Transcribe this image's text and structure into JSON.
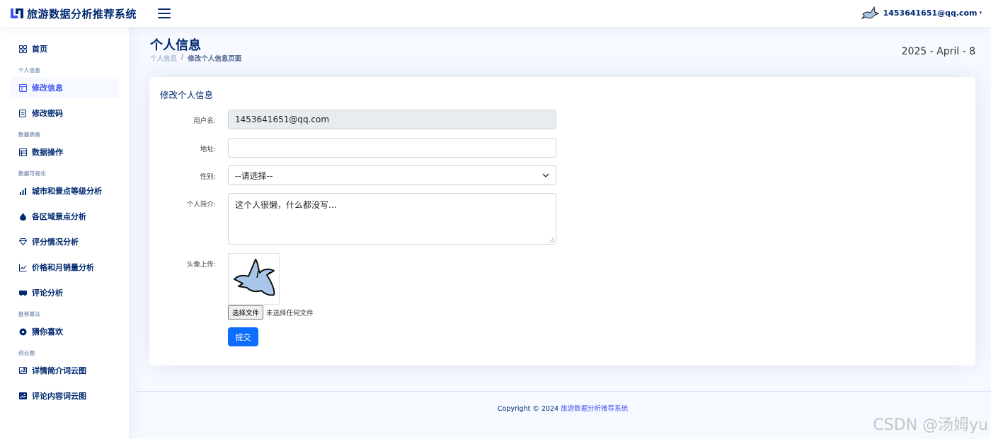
{
  "header": {
    "app_title": "旅游数据分析推荐系统",
    "user_name": "1453641651@qq.com",
    "caret": "▾"
  },
  "sidebar": {
    "items": [
      {
        "label": "首页",
        "icon": "grid-icon"
      },
      {
        "heading": "个人信息"
      },
      {
        "label": "修改信息",
        "icon": "layout-icon",
        "active": true
      },
      {
        "label": "修改密码",
        "icon": "document-icon"
      },
      {
        "heading": "数据表格"
      },
      {
        "label": "数据操作",
        "icon": "table-icon"
      },
      {
        "heading": "数据可视化"
      },
      {
        "label": "城市和景点等级分析",
        "icon": "bar-chart-icon"
      },
      {
        "label": "各区域景点分析",
        "icon": "droplet-icon"
      },
      {
        "label": "评分情况分析",
        "icon": "gem-icon"
      },
      {
        "label": "价格和月销量分析",
        "icon": "line-chart-icon"
      },
      {
        "label": "评论分析",
        "icon": "projector-icon"
      },
      {
        "heading": "推荐算法"
      },
      {
        "label": "猜你喜欢",
        "icon": "disc-icon"
      },
      {
        "heading": "词云图"
      },
      {
        "label": "详情简介词云图",
        "icon": "image-icon"
      },
      {
        "label": "评论内容词云图",
        "icon": "image-alt-icon"
      }
    ]
  },
  "page": {
    "title": "个人信息",
    "breadcrumb": [
      "个人信息",
      "/",
      "修改个人信息页面"
    ],
    "date": "2025 - April - 8"
  },
  "form": {
    "card_title": "修改个人信息",
    "username_label": "用户名:",
    "username_value": "1453641651@qq.com",
    "address_label": "地址:",
    "address_value": "",
    "gender_label": "性别:",
    "gender_value": "--请选择--",
    "bio_label": "个人简介:",
    "bio_value": "这个人很懒，什么都没写...",
    "avatar_label": "头像上传:",
    "file_button": "选择文件",
    "file_status": "未选择任何文件",
    "submit": "提交"
  },
  "footer": {
    "copyright": "Copyright © 2024 ",
    "brand": "旅游数据分析推荐系统"
  },
  "watermark": "CSDN @汤姆yu",
  "colors": {
    "primary": "#012970",
    "accent": "#4154f1",
    "button": "#0d6efd",
    "background": "#f6f9ff"
  }
}
